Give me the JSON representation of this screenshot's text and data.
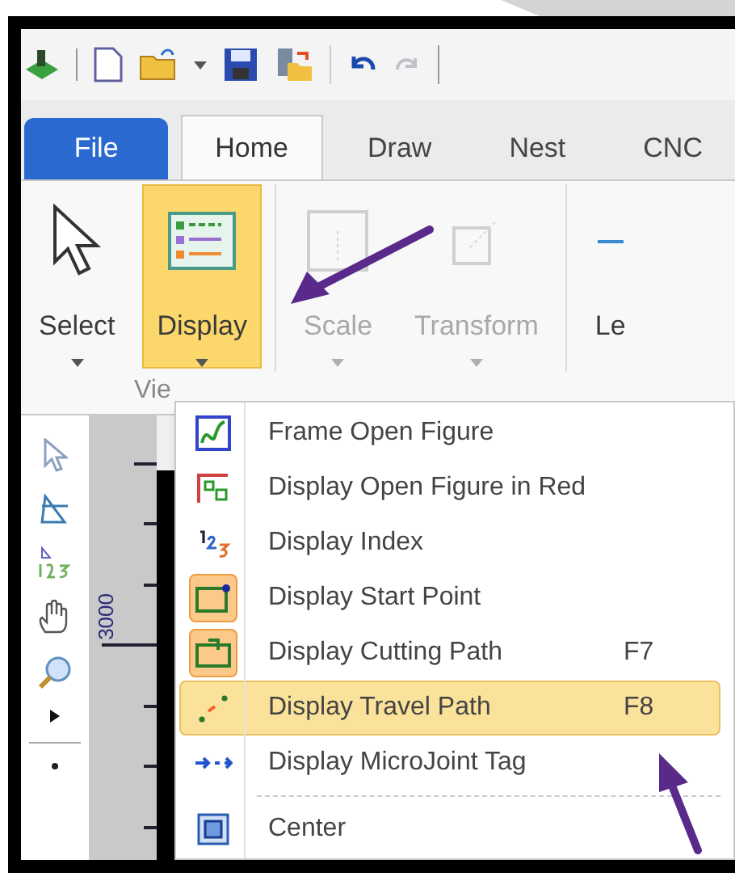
{
  "tabs": [
    {
      "label": "File",
      "kind": "file",
      "selected": false
    },
    {
      "label": "Home",
      "kind": "tab",
      "selected": true
    },
    {
      "label": "Draw",
      "kind": "tab",
      "selected": false
    },
    {
      "label": "Nest",
      "kind": "tab",
      "selected": false
    },
    {
      "label": "CNC",
      "kind": "tab",
      "selected": false
    }
  ],
  "ribbon": {
    "buttons": [
      {
        "label": "Select",
        "selected": false,
        "disabled": false
      },
      {
        "label": "Display",
        "selected": true,
        "disabled": false
      },
      {
        "label": "Scale",
        "selected": false,
        "disabled": true
      },
      {
        "label": "Transform",
        "selected": false,
        "disabled": true
      },
      {
        "label": "Le",
        "selected": false,
        "disabled": false
      }
    ],
    "group_label": "Vie"
  },
  "ruler": {
    "label": "3000"
  },
  "menu": {
    "items": [
      {
        "kind": "item",
        "label": "Frame Open Figure",
        "checked": false,
        "selected": false
      },
      {
        "kind": "item",
        "label": "Display Open Figure in Red",
        "checked": false,
        "selected": false
      },
      {
        "kind": "item",
        "label": "Display Index",
        "checked": false,
        "selected": false
      },
      {
        "kind": "item",
        "label": "Display Start Point",
        "checked": true,
        "selected": false
      },
      {
        "kind": "item",
        "label": "Display Cutting Path",
        "shortcut": "F7",
        "checked": true,
        "selected": false
      },
      {
        "kind": "item",
        "label": "Display Travel Path",
        "shortcut": "F8",
        "checked": false,
        "selected": true
      },
      {
        "kind": "item",
        "label": "Display MicroJoint Tag",
        "checked": false,
        "selected": false
      },
      {
        "kind": "separator"
      },
      {
        "kind": "item",
        "label": "Center",
        "checked": false,
        "selected": false
      }
    ]
  }
}
